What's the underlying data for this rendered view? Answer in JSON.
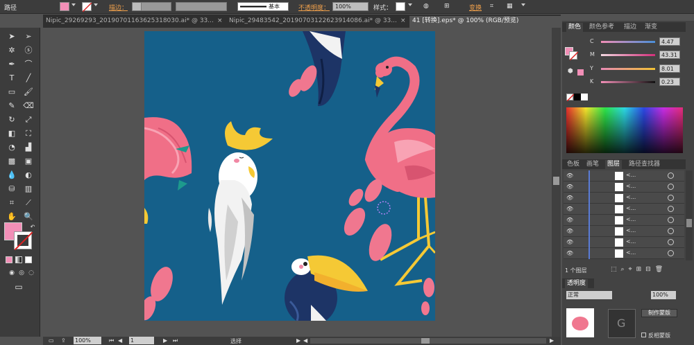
{
  "topbar": {
    "object_type": "路径",
    "stroke_label": "描边：",
    "stroke_style": "基本",
    "opacity_label": "不透明度：",
    "opacity_value": "100%",
    "style_label": "样式：",
    "transform_label": "变换",
    "fill_color": "#f28fb7"
  },
  "tabs": [
    {
      "label": "Nipic_29269293_20190701163625318030.ai* @ 33..."
    },
    {
      "label": "Nipic_29483542_20190703122623914086.ai* @ 33..."
    },
    {
      "label": "41 [转换].eps* @ 100% (RGB/预览)"
    }
  ],
  "status": {
    "zoom": "100%",
    "page": "1",
    "tool": "选择"
  },
  "color_panel": {
    "tabs": [
      "颜色",
      "颜色参考",
      "描边",
      "渐变"
    ],
    "rows": [
      {
        "letter": "C",
        "value": "4.47",
        "color": "#e27ab0"
      },
      {
        "letter": "M",
        "value": "43.31",
        "color": "#d07090"
      },
      {
        "letter": "Y",
        "value": "8.01",
        "color": "#e08a6b"
      },
      {
        "letter": "K",
        "value": "0.23",
        "color": "#d87ab0"
      }
    ]
  },
  "layers_panel": {
    "tabs": [
      "色板",
      "画笔",
      "图层",
      "路径查找器"
    ],
    "row_label": "<...",
    "count_label": "1 个图层"
  },
  "transparency_panel": {
    "tab": "透明度",
    "mode_partial": "正常",
    "opacity_value": "100%",
    "make_mask_button": "制作蒙版",
    "invert_mask": "反相蒙版"
  }
}
